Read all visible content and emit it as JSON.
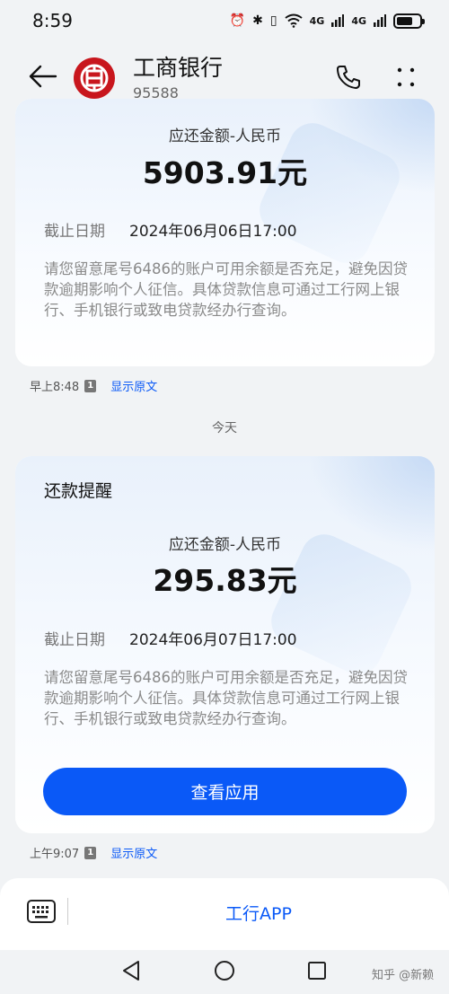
{
  "status_bar": {
    "time": "8:59",
    "signal_1": "4G",
    "signal_2": "4G",
    "battery_level": 0.7
  },
  "header": {
    "sender_name": "工商银行",
    "sender_number": "95588",
    "brand_color": "#c8161d"
  },
  "messages": [
    {
      "amount_label": "应还金额-人民币",
      "amount": "5903.91元",
      "deadline_label": "截止日期",
      "deadline": "2024年06月06日17:00",
      "notice": "请您留意尾号6486的账户可用余额是否充足，避免因贷款逾期影响个人征信。具体贷款信息可通过工行网上银行、手机银行或致电贷款经办行查询。",
      "time": "早上8:48",
      "sim": "1",
      "show_original": "显示原文"
    },
    {
      "title": "还款提醒",
      "amount_label": "应还金额-人民币",
      "amount": "295.83元",
      "deadline_label": "截止日期",
      "deadline": "2024年06月07日17:00",
      "notice": "请您留意尾号6486的账户可用余额是否充足，避免因贷款逾期影响个人征信。具体贷款信息可通过工行网上银行、手机银行或致电贷款经办行查询。",
      "button_label": "查看应用",
      "time": "上午9:07",
      "sim": "1",
      "show_original": "显示原文"
    }
  ],
  "date_separator": "今天",
  "bottom_bar": {
    "app_link": "工行APP"
  },
  "watermark": "知乎 @新赖",
  "colors": {
    "accent": "#0a59f7",
    "brand": "#c8161d",
    "background": "#f1f3f5"
  },
  "icons": [
    "back-arrow-icon",
    "icbc-logo",
    "phone-icon",
    "more-icon",
    "keyboard-icon",
    "nav-back-icon",
    "nav-home-icon",
    "nav-recent-icon"
  ]
}
